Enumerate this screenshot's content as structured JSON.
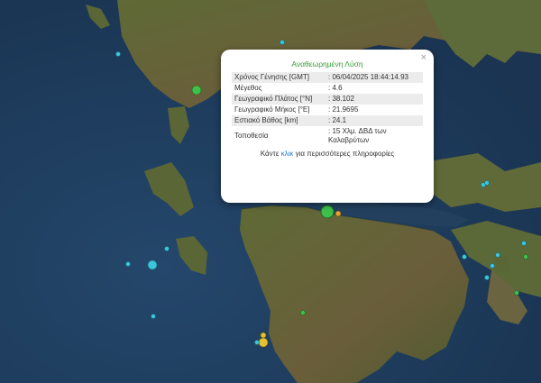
{
  "popup": {
    "close_glyph": "×",
    "title": "Αναθεωρημένη Λύση",
    "rows": [
      {
        "label": "Χρόνος Γένησης [GMT]",
        "sep": ":",
        "value": "06/04/2025 18:44:14.93"
      },
      {
        "label": "Μέγεθος",
        "sep": ":",
        "value": "4.6"
      },
      {
        "label": "Γεωγραφικό Πλάτος [°N]",
        "sep": ":",
        "value": "38.102"
      },
      {
        "label": "Γεωγραφικό Μήκος [°E]",
        "sep": ":",
        "value": "21.9695"
      },
      {
        "label": "Εστιακό Βάθος [km]",
        "sep": ":",
        "value": "24.1"
      },
      {
        "label": "Τοποθεσία",
        "sep": ":",
        "value": "15 Χλμ. ΔΒΔ των Καλαβρύτων"
      }
    ],
    "more_prefix": "Κάντε",
    "more_link": "κλικ",
    "more_suffix": "για περισσότερες πληροφορίες"
  },
  "colors": {
    "sea": "#1f3c5c",
    "land": "#5a5a34",
    "marker_cyan": "#3cc6dc",
    "marker_green": "#3fc04a",
    "marker_yellow": "#e6c030",
    "marker_orange": "#e8a030"
  },
  "markers": [
    {
      "color": "green",
      "magnitude": "large",
      "selected": true
    },
    {
      "color": "orange",
      "magnitude": "small"
    },
    {
      "color": "yellow",
      "magnitude": "small"
    },
    {
      "color": "yellow",
      "magnitude": "medium"
    },
    {
      "color": "green",
      "magnitude": "medium"
    },
    {
      "color": "cyan",
      "magnitude": "medium"
    },
    {
      "color": "cyan",
      "magnitude": "small"
    },
    {
      "color": "cyan",
      "magnitude": "small"
    },
    {
      "color": "cyan",
      "magnitude": "small"
    },
    {
      "color": "cyan",
      "magnitude": "small"
    },
    {
      "color": "cyan",
      "magnitude": "small"
    },
    {
      "color": "cyan",
      "magnitude": "small"
    },
    {
      "color": "cyan",
      "magnitude": "small"
    },
    {
      "color": "cyan",
      "magnitude": "small"
    },
    {
      "color": "cyan",
      "magnitude": "small"
    },
    {
      "color": "cyan",
      "magnitude": "small"
    },
    {
      "color": "cyan",
      "magnitude": "small"
    },
    {
      "color": "cyan",
      "magnitude": "small"
    },
    {
      "color": "green",
      "magnitude": "small"
    },
    {
      "color": "green",
      "magnitude": "small"
    },
    {
      "color": "green",
      "magnitude": "small"
    },
    {
      "color": "green",
      "magnitude": "small"
    }
  ]
}
